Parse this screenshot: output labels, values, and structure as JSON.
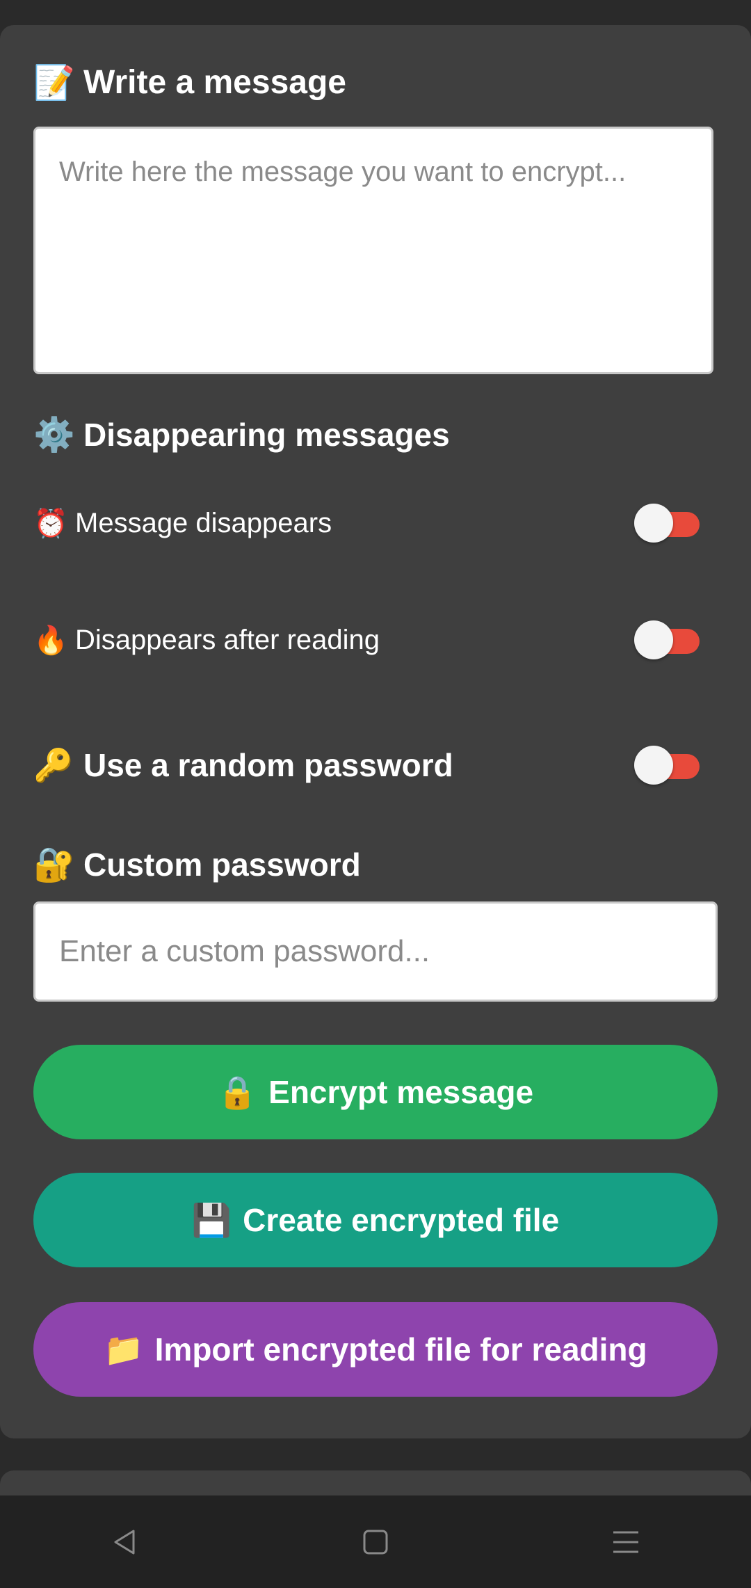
{
  "compose": {
    "title": "Write a message",
    "title_emoji": "📝",
    "message_placeholder": "Write here the message you want to encrypt...",
    "message_value": ""
  },
  "disappearing": {
    "title": "Disappearing messages",
    "title_emoji": "⚙️",
    "options": [
      {
        "emoji": "⏰",
        "label": "Message disappears",
        "enabled": false
      },
      {
        "emoji": "🔥",
        "label": "Disappears after reading",
        "enabled": false
      }
    ]
  },
  "random_password": {
    "emoji": "🔑",
    "label": "Use a random password",
    "enabled": false
  },
  "custom_password": {
    "title": "Custom password",
    "title_emoji": "🔐",
    "placeholder": "Enter a custom password...",
    "value": ""
  },
  "actions": {
    "encrypt": {
      "emoji": "🔒",
      "label": "Encrypt message",
      "color": "#27ae60"
    },
    "create_file": {
      "emoji": "💾",
      "label": "Create encrypted file",
      "color": "#16a085"
    },
    "import_file": {
      "emoji": "📁",
      "label": "Import encrypted file for reading",
      "color": "#8e44ad"
    }
  },
  "colors": {
    "toggle_off_track": "#e84a3b",
    "card_bg": "#3f3f3f",
    "page_bg": "#2a2a2a"
  },
  "navbar": {
    "icons": [
      "back-icon",
      "home-icon",
      "menu-icon"
    ]
  }
}
